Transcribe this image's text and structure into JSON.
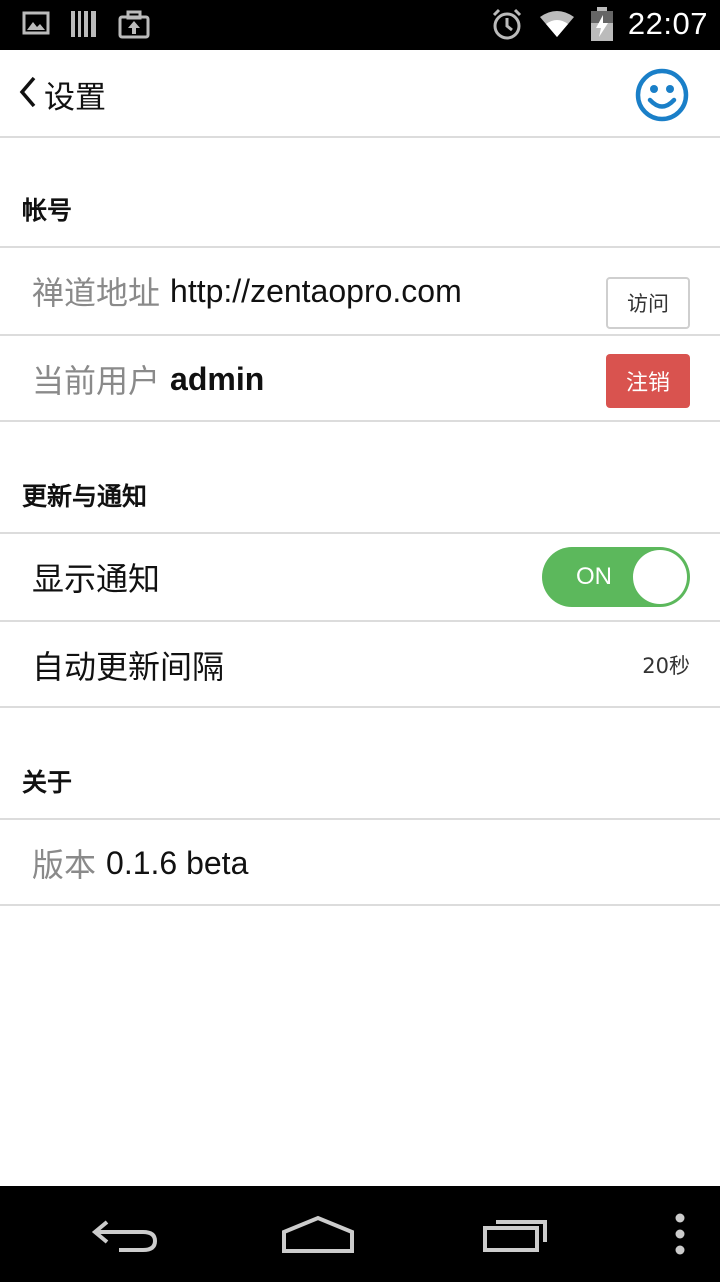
{
  "status_bar": {
    "time": "22:07",
    "left_icons": [
      "gallery-icon",
      "barcode-icon",
      "briefcase-upload-icon"
    ],
    "right_icons": [
      "alarm-icon",
      "wifi-icon",
      "battery-charging-icon"
    ]
  },
  "header": {
    "back_label": "设置",
    "avatar_icon": "smiley-face-icon",
    "accent_color": "#1a7fc8"
  },
  "sections": {
    "account": {
      "title": "帐号",
      "server_label": "禅道地址",
      "server_value": "http://zentaopro.com",
      "visit_button": "访问",
      "user_label": "当前用户",
      "user_value": "admin",
      "logout_button": "注销",
      "logout_color": "#d9534f"
    },
    "notify": {
      "title": "更新与通知",
      "show_label": "显示通知",
      "toggle_state": "ON",
      "toggle_color": "#5cb85c",
      "interval_label": "自动更新间隔",
      "interval_value": "20秒"
    },
    "about": {
      "title": "关于",
      "version_label": "版本",
      "version_value": "0.1.6 beta"
    }
  },
  "nav_bar": {
    "buttons": [
      "back-icon",
      "home-icon",
      "recent-apps-icon",
      "overflow-menu-icon"
    ]
  }
}
